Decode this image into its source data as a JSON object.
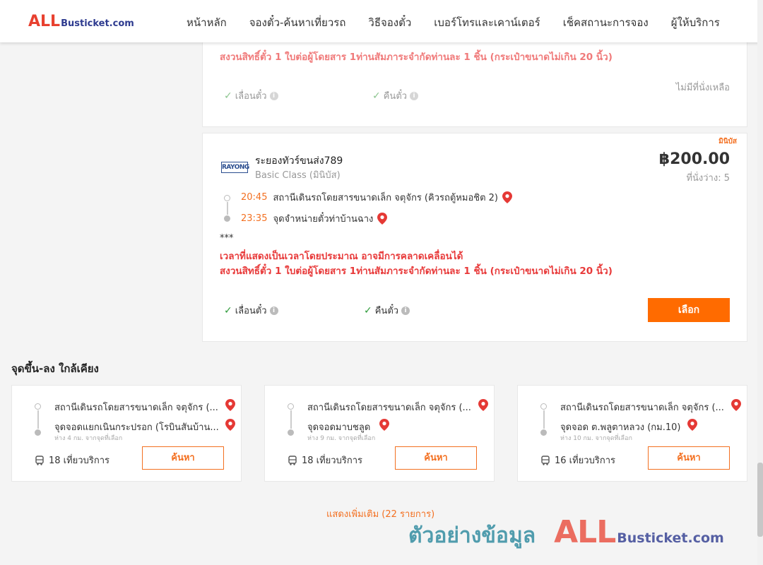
{
  "header": {
    "logo_all": "ALL",
    "logo_bus": "Busticket.com",
    "nav": [
      "หน้าหลัก",
      "จองตั๋ว-ค้นหาเที่ยวรถ",
      "วิธีจองตั๋ว",
      "เบอร์โทรและเคาน์เตอร์",
      "เช็คสถานะการจอง",
      "ผู้ให้บริการ"
    ]
  },
  "card1": {
    "warning": "สงวนสิทธิ์ตั๋ว 1 ใบต่อผู้โดยสาร 1ท่านสัมภาระจำกัดท่านละ 1 ชิ้น (กระเป๋าขนาดไม่เกิน 20 นิ้ว)",
    "feature_1": "เลื่อนตั๋ว",
    "feature_2": "คืนตั๋ว",
    "no_seat": "ไม่มีที่นั่งเหลือ"
  },
  "card2": {
    "badge": "มินิบัส",
    "operator_logo": "RAYONG",
    "operator_name": "ระยองทัวร์ขนส่ง789",
    "bus_class": "Basic Class (มินิบัส)",
    "price": "฿200.00",
    "seats": "ที่นั่งว่าง: 5",
    "depart_time": "20:45",
    "depart_place": "สถานีเดินรถโดยสารขนาดเล็ก จตุจักร (คิวรถตู้หมอชิต 2)",
    "arrive_time": "23:35",
    "arrive_place": "จุดจำหน่ายตั๋วท่าบ้านฉาง",
    "note_stars": "***",
    "warning_1": "เวลาที่แสดงเป็นเวลาโดยประมาณ อาจมีการคลาดเคลื่อนได้",
    "warning_2": "สงวนสิทธิ์ตั๋ว 1 ใบต่อผู้โดยสาร 1ท่านสัมภาระจำกัดท่านละ 1 ชิ้น (กระเป๋าขนาดไม่เกิน 20 นิ้ว)",
    "feature_1": "เลื่อนตั๋ว",
    "feature_2": "คืนตั๋ว",
    "select_label": "เลือก"
  },
  "nearby": {
    "title": "จุดขึ้น-ลง ใกล้เคียง",
    "items": [
      {
        "from": "สถานีเดินรถโดยสารขนาดเล็ก จตุจักร (...",
        "to": "จุดจอดแยกเนินกระปรอก (โรบินสันบ้าน...",
        "distance": "ห่าง 4 กม. จากจุดที่เลือก",
        "trips": "18 เที่ยวบริการ",
        "button": "ค้นหา"
      },
      {
        "from": "สถานีเดินรถโดยสารขนาดเล็ก จตุจักร (...",
        "to": "จุดจอดมาบชลูด",
        "distance": "ห่าง 9 กม. จากจุดที่เลือก",
        "trips": "18 เที่ยวบริการ",
        "button": "ค้นหา"
      },
      {
        "from": "สถานีเดินรถโดยสารขนาดเล็ก จตุจักร (...",
        "to": "จุดจอด ต.พลูตาหลวง (กม.10)",
        "distance": "ห่าง 10 กม. จากจุดที่เลือก",
        "trips": "16 เที่ยวบริการ",
        "button": "ค้นหา"
      }
    ]
  },
  "more_link": "แสดงเพิ่มเติม (22 รายการ)",
  "watermark": {
    "thai": "ตัวอย่างข้อมูล",
    "all": "ALL",
    "bus": "Busticket.com"
  }
}
